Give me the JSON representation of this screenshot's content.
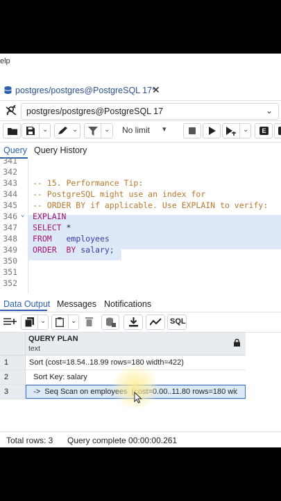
{
  "menu": {
    "partial_label": "elp"
  },
  "tab": {
    "title": "postgres/postgres@PostgreSQL 17*",
    "close": "✕"
  },
  "connection": {
    "value": "postgres/postgres@PostgreSQL 17"
  },
  "toolbar": {
    "limit_value": "No limit"
  },
  "query_tabs": [
    {
      "label": "Query",
      "active": true
    },
    {
      "label": "Query History",
      "active": false
    }
  ],
  "editor": {
    "lines": [
      {
        "num": "341",
        "code": ""
      },
      {
        "num": "342",
        "code": ""
      },
      {
        "num": "343",
        "code": "-- 15. Performance Tip:"
      },
      {
        "num": "344",
        "code": "-- PostgreSQL might use an index for"
      },
      {
        "num": "345",
        "code": "-- ORDER BY if applicable. Use EXPLAIN to verify:"
      },
      {
        "num": "346",
        "code": "EXPLAIN",
        "fold": "⌄"
      },
      {
        "num": "347",
        "code_kw": "SELECT",
        "code_rest": " *"
      },
      {
        "num": "348",
        "code_kw": "FROM",
        "code_rest": "   employees"
      },
      {
        "num": "349",
        "code_kw": "ORDER  BY",
        "code_rest": " salary;"
      },
      {
        "num": "350",
        "code": ""
      },
      {
        "num": "351",
        "code": ""
      },
      {
        "num": "352",
        "code": ""
      }
    ]
  },
  "result_tabs": [
    {
      "label": "Data Output",
      "active": true
    },
    {
      "label": "Messages",
      "active": false
    },
    {
      "label": "Notifications",
      "active": false
    }
  ],
  "results_toolbar": {
    "sql_label": "SQL"
  },
  "grid": {
    "column": {
      "name": "QUERY PLAN",
      "type": "text"
    },
    "rows": [
      {
        "n": "1",
        "value": "Sort  (cost=18.54..18.99 rows=180 width=422)"
      },
      {
        "n": "2",
        "value": "  Sort Key: salary"
      },
      {
        "n": "3",
        "value": "  ->  Seq Scan on employees  (cost=0.00..11.80 rows=180 width=..."
      }
    ]
  },
  "status": {
    "total_rows": "Total rows: 3",
    "query_complete": "Query complete 00:00:00.261"
  }
}
